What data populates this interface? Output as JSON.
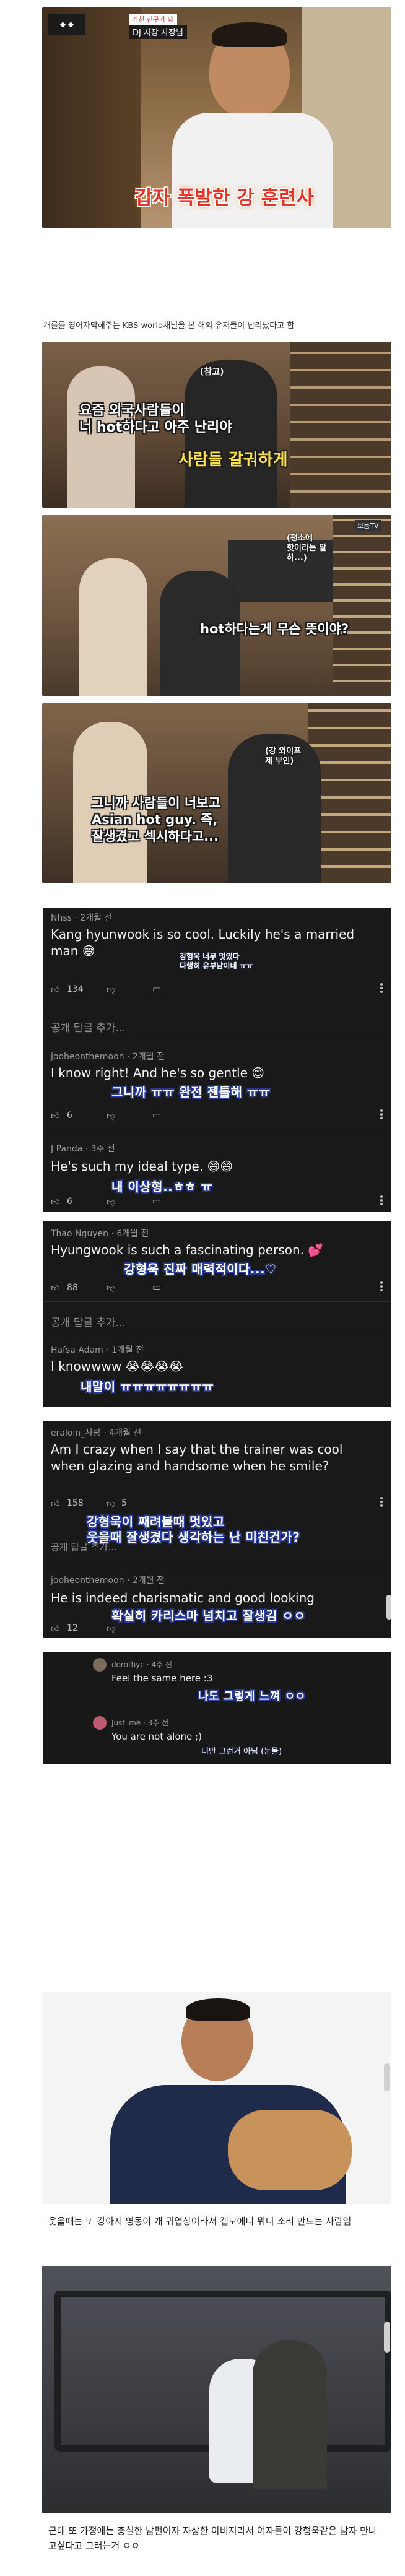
{
  "top_banner": {
    "tag_small": "거친 친구가 돼",
    "tag_main": "DJ 사장 사장님",
    "headline": "갑자 폭발한 강 훈련사"
  },
  "intro_caption": "개를를 영어자막해주는 KBS world채널을 본 해외 유저들이 난리났다고 합",
  "scenes": [
    {
      "label_small": "(참고)",
      "subtitle_white": "요즘 외국사람들이\n너 hot하다고 아주 난리야",
      "subtitle_yellow": "사람들 갈궈하게"
    },
    {
      "label_small": "(평소에\n핫이라는 말\n하...)",
      "subtitle_white": "hot하다는게 무슨 뜻이야?",
      "tag": "보듬TV"
    },
    {
      "label_small": "(강 와이프\n제 부인)",
      "subtitle_white": "그니까 사람들이 너보고\nAsian hot guy. 즉,\n잘생겼고 섹시하다고..."
    }
  ],
  "comments": [
    {
      "name": "Nhss · 2개월 전",
      "text": "Kang hyunwook is so cool. Luckily he's a married man 😅",
      "sub": "강형욱 너무 멋있다\n다행히 유부남이네 ㅠㅠ",
      "likes": "134",
      "has_reply_bar": true
    },
    {
      "name": "jooheonthemoon · 2개월 전",
      "text": "I know right! And he's so gentle 😊",
      "sub": "그니까 ㅠㅠ 완전 젠틀해 ㅠㅠ",
      "likes": "6"
    },
    {
      "name": "J Panda · 3주 전",
      "text": "He's such my ideal type. 😄😄",
      "sub": "내 이상형..ㅎㅎ ㅠ",
      "likes": "6"
    },
    {
      "name": "Thao Nguyen · 6개월 전",
      "text": "Hyungwook is such a fascinating person. 💕",
      "sub": "강형욱 진짜 매력적이다...♡",
      "likes": "88"
    },
    {
      "name": "Hafsa Adam · 1개월 전",
      "text": "I knowwww 😭😭😭😭",
      "sub": "내말이 ㅠㅠㅠㅠㅠㅠㅠㅠ",
      "likes": ""
    },
    {
      "name": "eraloin_사랑 · 4개월 전",
      "text": "Am I crazy when I say that the trainer was cool when glazing and handsome when he smile?",
      "sub": "강형욱이 째려볼때 멋있고\n웃을때 잘생겼다 생각하는 난 미친건가?",
      "likes": "158",
      "dislikes": "5"
    },
    {
      "name": "jooheonthemoon · 2개월 전",
      "text": "He is indeed charismatic and good looking",
      "sub": "확실히 카리스마 넘치고 잘생김 ㅇㅇ",
      "likes": "12"
    }
  ],
  "reply_label": "공개 답글 추가...",
  "mini_comments": [
    {
      "name": "dorothyc · 4주 전",
      "text": "Feel the same here :3",
      "sub": "나도 그렇게 느껴 ㅇㅇ"
    },
    {
      "name": "Just_me · 3주 전",
      "text": "You are not alone ;)",
      "sub": "너만 그런거 아님 (눈물)"
    }
  ],
  "dog_caption": "웃을때는 또 강아지 영동이 개 귀엽상이라서 갭모에니 뭐니 소리 만드는 사람임",
  "family_caption": "근데 또 가정에는 충실한 남편이자 자상한 아버지라서 여자들이 강형욱같은 남자 만나고싶다고 그러는거 ㅇㅇ",
  "colors": {
    "panel_bg": "#191919",
    "sub_outline": "#2a3c9a",
    "headline_red": "#e7332a",
    "subtitle_yellow": "#ffe14a"
  }
}
